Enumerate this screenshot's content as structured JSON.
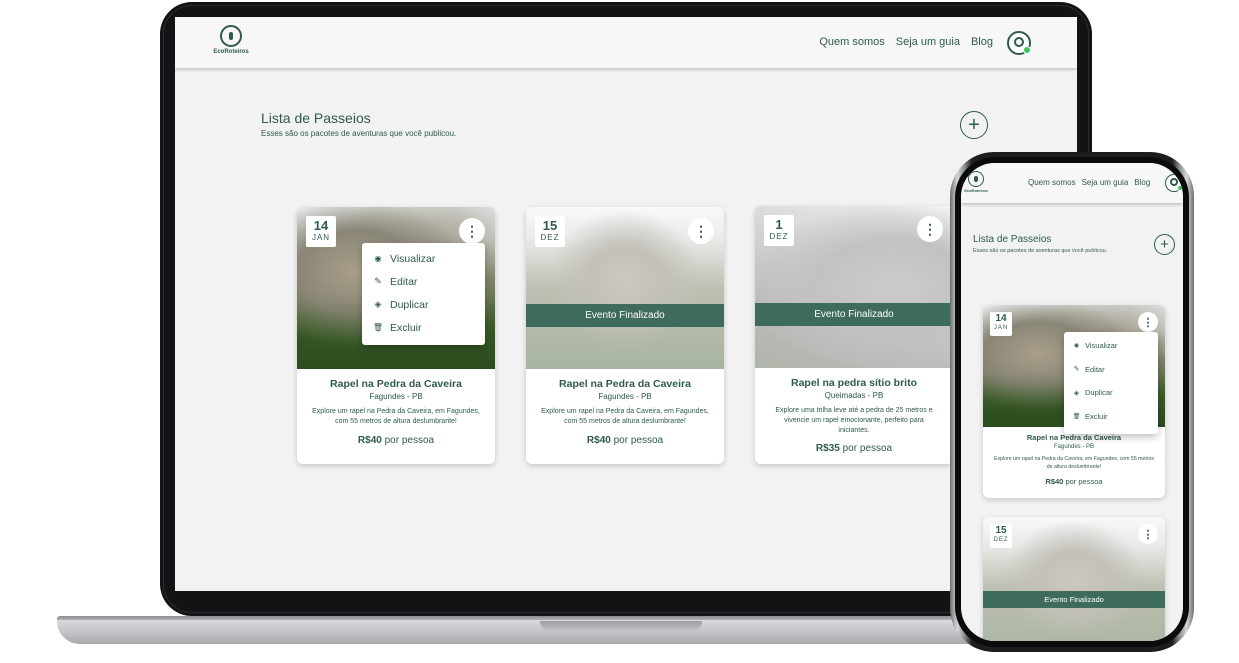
{
  "brand": {
    "name": "EcoRoteiros"
  },
  "nav": {
    "links": [
      "Quem somos",
      "Seja um guia",
      "Blog"
    ]
  },
  "page": {
    "title": "Lista de Passeios",
    "subtitle": "Esses são os pacotes de aventuras que você publicou.",
    "add_icon": "+"
  },
  "kebab_icon": "⋮",
  "menu": {
    "items": [
      {
        "label": "Visualizar",
        "icon": "eye-icon",
        "glyph": "◉"
      },
      {
        "label": "Editar",
        "icon": "pencil-icon",
        "glyph": "✎"
      },
      {
        "label": "Duplicar",
        "icon": "layers-icon",
        "glyph": "◈"
      },
      {
        "label": "Excluir",
        "icon": "trash-icon",
        "glyph": "🗑"
      }
    ]
  },
  "cards": [
    {
      "day": "14",
      "month": "JAN",
      "title": "Rapel na Pedra da Caveira",
      "location": "Fagundes - PB",
      "description": "Explore um rapel na Pedra da Caveira, em Fagundes, com 55 metros de altura deslumbrante!",
      "price": "R$40",
      "price_suffix": "por pessoa",
      "finished": false
    },
    {
      "day": "15",
      "month": "DEZ",
      "title": "Rapel na Pedra da Caveira",
      "location": "Fagundes - PB",
      "description": "Explore um rapel na Pedra da Caveira, em Fagundes, com 55 metros de altura deslumbrante!",
      "price": "R$40",
      "price_suffix": "por pessoa",
      "finished": true,
      "finished_label": "Evento Finalizado"
    },
    {
      "day": "1",
      "month": "DEZ",
      "title": "Rapel na pedra sítio brito",
      "location": "Queimadas - PB",
      "description": "Explore uma trilha leve até a pedra de 25 metros e vivencie um rapel emocionante, perfeito para iniciantes.",
      "price": "R$35",
      "price_suffix": "por pessoa",
      "finished": true,
      "finished_label": "Evento Finalizado"
    }
  ],
  "colors": {
    "primary": "#2f5a4f",
    "band": "#3f6b5c",
    "online": "#3fc45a",
    "background": "#f2f2f2"
  }
}
